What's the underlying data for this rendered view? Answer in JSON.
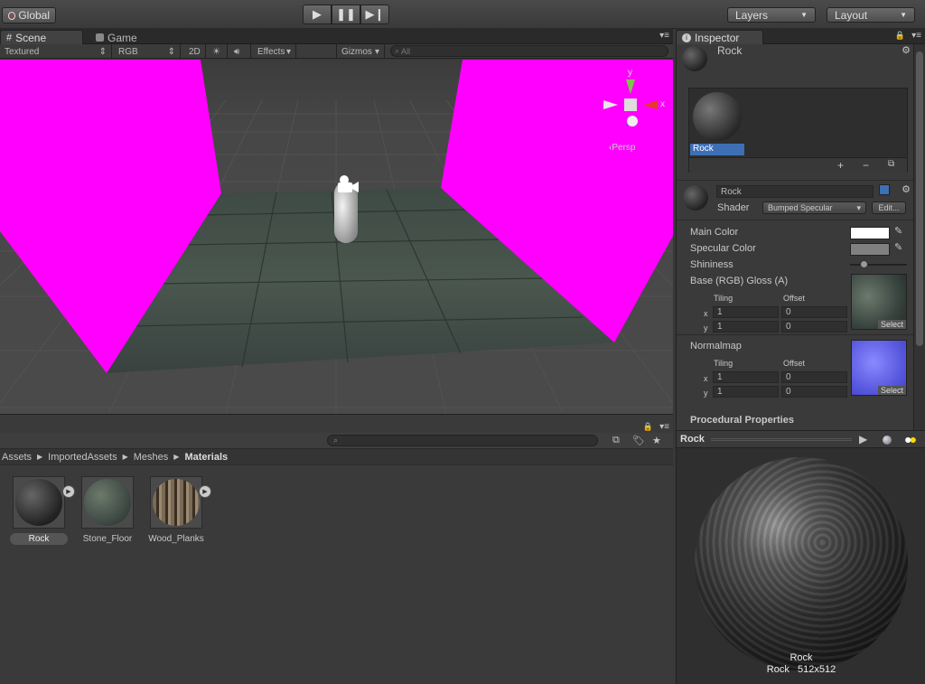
{
  "toolbar": {
    "global_label": "Global",
    "layers_label": "Layers",
    "layout_label": "Layout"
  },
  "tabs": {
    "scene": "Scene",
    "game": "Game",
    "inspector": "Inspector"
  },
  "scene_bar": {
    "render_mode": "Textured",
    "color_mode": "RGB",
    "mode_2d": "2D",
    "effects": "Effects",
    "gizmos": "Gizmos",
    "search_placeholder": "All"
  },
  "gizmo": {
    "y": "y",
    "x": "x",
    "persp": "Persp"
  },
  "breadcrumb": [
    "Assets",
    "ImportedAssets",
    "Meshes",
    "Materials"
  ],
  "assets": [
    {
      "name": "Rock",
      "selected": true,
      "has_play": true
    },
    {
      "name": "Stone_Floor",
      "selected": false,
      "has_play": false
    },
    {
      "name": "Wood_Planks",
      "selected": false,
      "has_play": true
    }
  ],
  "inspector": {
    "header_name": "Rock",
    "preview_tile_label": "Rock",
    "material_name": "Rock",
    "shader_label": "Shader",
    "shader_value": "Bumped Specular",
    "edit_button": "Edit...",
    "main_color_label": "Main Color",
    "main_color": "#ffffff",
    "specular_color_label": "Specular Color",
    "specular_color": "#808080",
    "shininess_label": "Shininess",
    "base_label": "Base (RGB) Gloss (A)",
    "normalmap_label": "Normalmap",
    "tiling_label": "Tiling",
    "offset_label": "Offset",
    "x_label": "x",
    "y_label": "y",
    "base_tiling_x": "1",
    "base_tiling_y": "1",
    "base_offset_x": "0",
    "base_offset_y": "0",
    "normal_tiling_x": "1",
    "normal_tiling_y": "1",
    "normal_offset_x": "0",
    "normal_offset_y": "0",
    "select_label": "Select",
    "procedural_label": "Procedural Properties"
  },
  "preview": {
    "title": "Rock",
    "caption_name": "Rock",
    "caption_info": "Rock   512x512"
  },
  "colors": {
    "magenta": "#ff00ff",
    "selection_blue": "#3d6fb5"
  }
}
